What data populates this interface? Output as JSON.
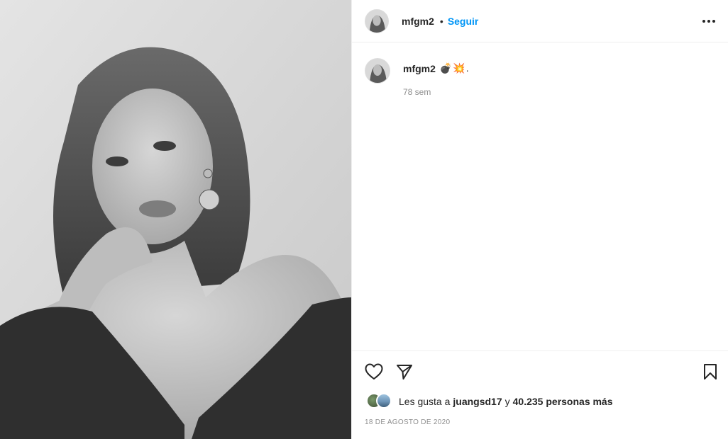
{
  "post": {
    "image_alt": "Black and white portrait photo"
  },
  "header": {
    "username": "mfgm2",
    "separator": "•",
    "follow_label": "Seguir",
    "more_icon": "more-horizontal-icon"
  },
  "caption": {
    "username": "mfgm2",
    "text": "💣💥.",
    "time": "78 sem"
  },
  "actions": {
    "like_icon": "heart-icon",
    "share_icon": "paper-plane-icon",
    "save_icon": "bookmark-icon"
  },
  "likes": {
    "prefix": "Les gusta a",
    "user": "juangsd17",
    "conjunction": "y",
    "count": "40.235 personas más"
  },
  "date": "18 DE AGOSTO DE 2020",
  "colors": {
    "accent": "#0095f6",
    "text": "#262626",
    "muted": "#8e8e8e",
    "border": "#efefef"
  }
}
